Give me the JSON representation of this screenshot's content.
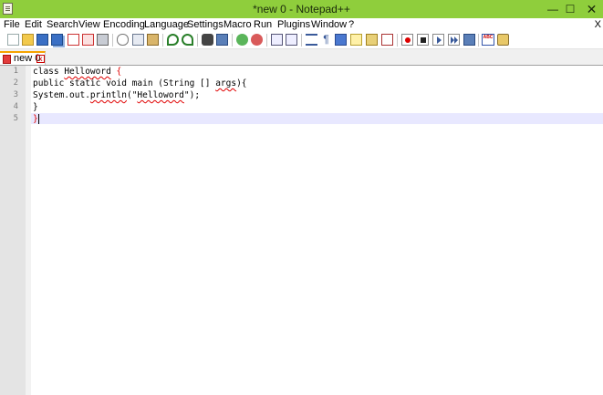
{
  "window": {
    "title": "*new  0 - Notepad++",
    "minimize_glyph": "—",
    "maximize_glyph": "☐",
    "close_glyph": "✕"
  },
  "menu": {
    "items": [
      "File",
      "Edit",
      "Search",
      "View",
      "Encoding",
      "Language",
      "Settings",
      "Macro",
      "Run",
      "Plugins",
      "Window",
      "?"
    ],
    "close_label": "X"
  },
  "toolbar": {
    "icons": [
      "new-file-icon",
      "open-file-icon",
      "save-icon",
      "save-all-icon",
      "close-icon",
      "close-all-icon",
      "print-icon",
      "cut-icon",
      "copy-icon",
      "paste-icon",
      "undo-icon",
      "redo-icon",
      "find-icon",
      "replace-icon",
      "zoom-in-icon",
      "zoom-out-icon",
      "sync-vertical-icon",
      "sync-horizontal-icon",
      "word-wrap-icon",
      "show-all-chars-icon",
      "indent-guide-icon",
      "user-language-icon",
      "doc-map-icon",
      "function-list-icon",
      "record-macro-icon",
      "stop-recording-icon",
      "playback-icon",
      "run-macro-multiple-icon",
      "save-macro-icon",
      "spell-check-icon",
      "auto-completion-icon"
    ]
  },
  "tabs": [
    {
      "label": "new  0",
      "close_glyph": "x"
    }
  ],
  "editor": {
    "line_numbers": [
      "1",
      "2",
      "3",
      "4",
      "5"
    ],
    "lines": [
      {
        "parts": [
          "class ",
          "Helloword",
          " ",
          "{"
        ]
      },
      {
        "parts": [
          "public static void main (String [] ",
          "args",
          "){"
        ]
      },
      {
        "parts": [
          "System.out.",
          "println",
          "(\"",
          "Helloword",
          "\");"
        ]
      },
      {
        "parts": [
          "}"
        ]
      },
      {
        "parts": [
          "}"
        ]
      }
    ]
  },
  "colors": {
    "titlebar": "#8fce3c",
    "tab_accent": "#f6a300",
    "current_line": "#e8e8ff",
    "error_squiggle": "#e00000"
  }
}
